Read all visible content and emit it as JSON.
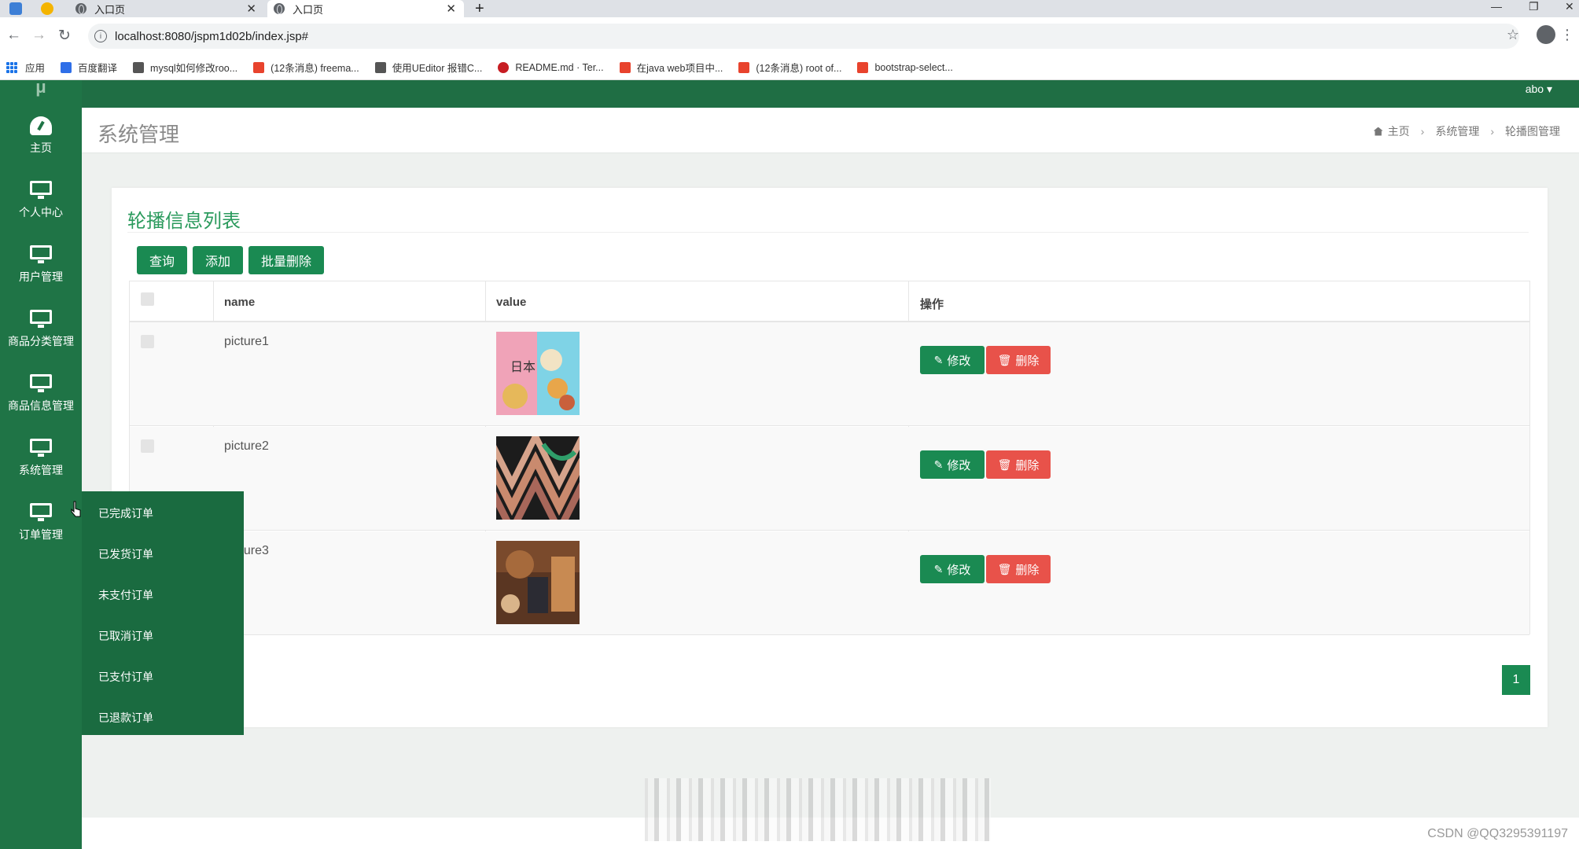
{
  "browser": {
    "tabs": [
      {
        "title": "入口页",
        "active": false
      },
      {
        "title": "入口页",
        "active": true
      }
    ],
    "new_tab": "+",
    "url": "localhost:8080/jspm1d02b/index.jsp#",
    "bookmarks": [
      {
        "label": "应用",
        "icon": "apps-grid-icon",
        "color": "#1a73e8"
      },
      {
        "label": "百度翻译",
        "icon": "baidu-translate-icon",
        "color": "#2f6fe8"
      },
      {
        "label": "mysql如何修改roo...",
        "icon": "bookmark-icon",
        "color": "#555555"
      },
      {
        "label": "(12条消息) freema...",
        "icon": "csdn-icon",
        "color": "#e8432d"
      },
      {
        "label": "使用UEditor 报错C...",
        "icon": "bookmark-icon",
        "color": "#555555"
      },
      {
        "label": "README.md · Ter...",
        "icon": "gitee-icon",
        "color": "#c71d23"
      },
      {
        "label": "在java web项目中...",
        "icon": "csdn-icon",
        "color": "#e8432d"
      },
      {
        "label": "(12条消息) root of...",
        "icon": "csdn-icon",
        "color": "#e8432d"
      },
      {
        "label": "bootstrap-select...",
        "icon": "bookmark-page-icon",
        "color": "#e8432d"
      }
    ]
  },
  "app": {
    "logo": "μ",
    "user": "abo ▾",
    "sidebar": [
      {
        "label": "主页",
        "icon": "dashboard-icon"
      },
      {
        "label": "个人中心",
        "icon": "monitor-icon"
      },
      {
        "label": "用户管理",
        "icon": "monitor-icon"
      },
      {
        "label": "商品分类管理",
        "icon": "monitor-icon"
      },
      {
        "label": "商品信息管理",
        "icon": "monitor-icon"
      },
      {
        "label": "系统管理",
        "icon": "monitor-icon"
      },
      {
        "label": "订单管理",
        "icon": "monitor-icon"
      }
    ],
    "flyout": [
      "已完成订单",
      "已发货订单",
      "未支付订单",
      "已取消订单",
      "已支付订单",
      "已退款订单"
    ],
    "page_title": "系统管理",
    "breadcrumb": [
      "主页",
      "系统管理",
      "轮播图管理"
    ],
    "card_title": "轮播信息列表",
    "buttons": {
      "query": "查询",
      "add": "添加",
      "batch_delete": "批量删除"
    },
    "table": {
      "headers": [
        "name",
        "value",
        "操作"
      ],
      "rows": [
        {
          "name": "picture1"
        },
        {
          "name": "picture2"
        },
        {
          "name": "picture3"
        }
      ],
      "edit_label": "修改",
      "delete_label": "删除"
    },
    "pagination": {
      "current": "1"
    },
    "watermark": "CSDN @QQ3295391197"
  },
  "colors": {
    "sidebar": "#1f7446",
    "primary": "#1a8a52",
    "danger": "#e8524a",
    "title_green": "#2a9a5c"
  }
}
